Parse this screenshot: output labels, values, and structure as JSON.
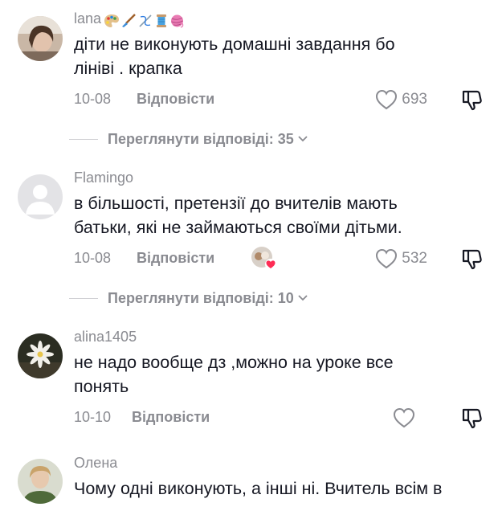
{
  "comments": [
    {
      "username": "lana",
      "username_emojis": [
        "palette-emoji",
        "paintbrush-emoji",
        "needle-emoji",
        "thread-spool-emoji",
        "yarn-emoji"
      ],
      "text": "діти не виконують домашні завдання бо\nлініві . крапка",
      "date": "10-08",
      "reply_label": "Відповісти",
      "likes": "693",
      "view_replies": "Переглянути відповіді: 35"
    },
    {
      "username": "Flamingo",
      "text": "в більшості, претензії до вчителів мають\nбатьки, які не займаються своїми дітьми.",
      "date": "10-08",
      "reply_label": "Відповісти",
      "likes": "532",
      "view_replies": "Переглянути відповіді: 10"
    },
    {
      "username": "alina1405",
      "text": "не надо вообще дз ,можно на уроке все\nпонять",
      "date": "10-10",
      "reply_label": "Відповісти",
      "likes": ""
    },
    {
      "username": "Олена",
      "text": "Чому одні виконують, а інші ні. Вчитель всім в"
    }
  ],
  "colors": {
    "text_primary": "#161823",
    "text_secondary": "#8a8b91",
    "like_heart": "#fe2c55"
  }
}
